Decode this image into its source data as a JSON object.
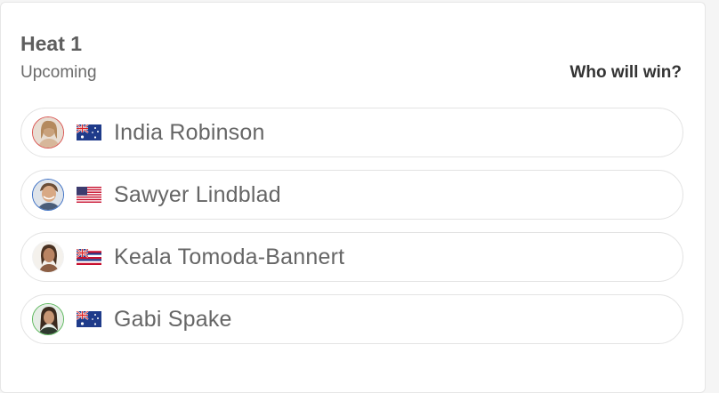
{
  "heat": {
    "title": "Heat 1",
    "status": "Upcoming",
    "who_will_win_label": "Who will win?"
  },
  "athletes": [
    {
      "name": "India Robinson",
      "flag": "australia-flag",
      "ring_color": "#d9534f"
    },
    {
      "name": "Sawyer Lindblad",
      "flag": "usa-flag",
      "ring_color": "#3b6fc4"
    },
    {
      "name": "Keala Tomoda-Bannert",
      "flag": "hawaii-flag",
      "ring_color": "#f2f2f2"
    },
    {
      "name": "Gabi Spake",
      "flag": "australia-flag",
      "ring_color": "#5cb85c"
    }
  ],
  "colors": {
    "card_background": "#ffffff",
    "page_background": "#f5f5f5",
    "title_text": "#5e5e5e",
    "link_text": "#333333"
  }
}
